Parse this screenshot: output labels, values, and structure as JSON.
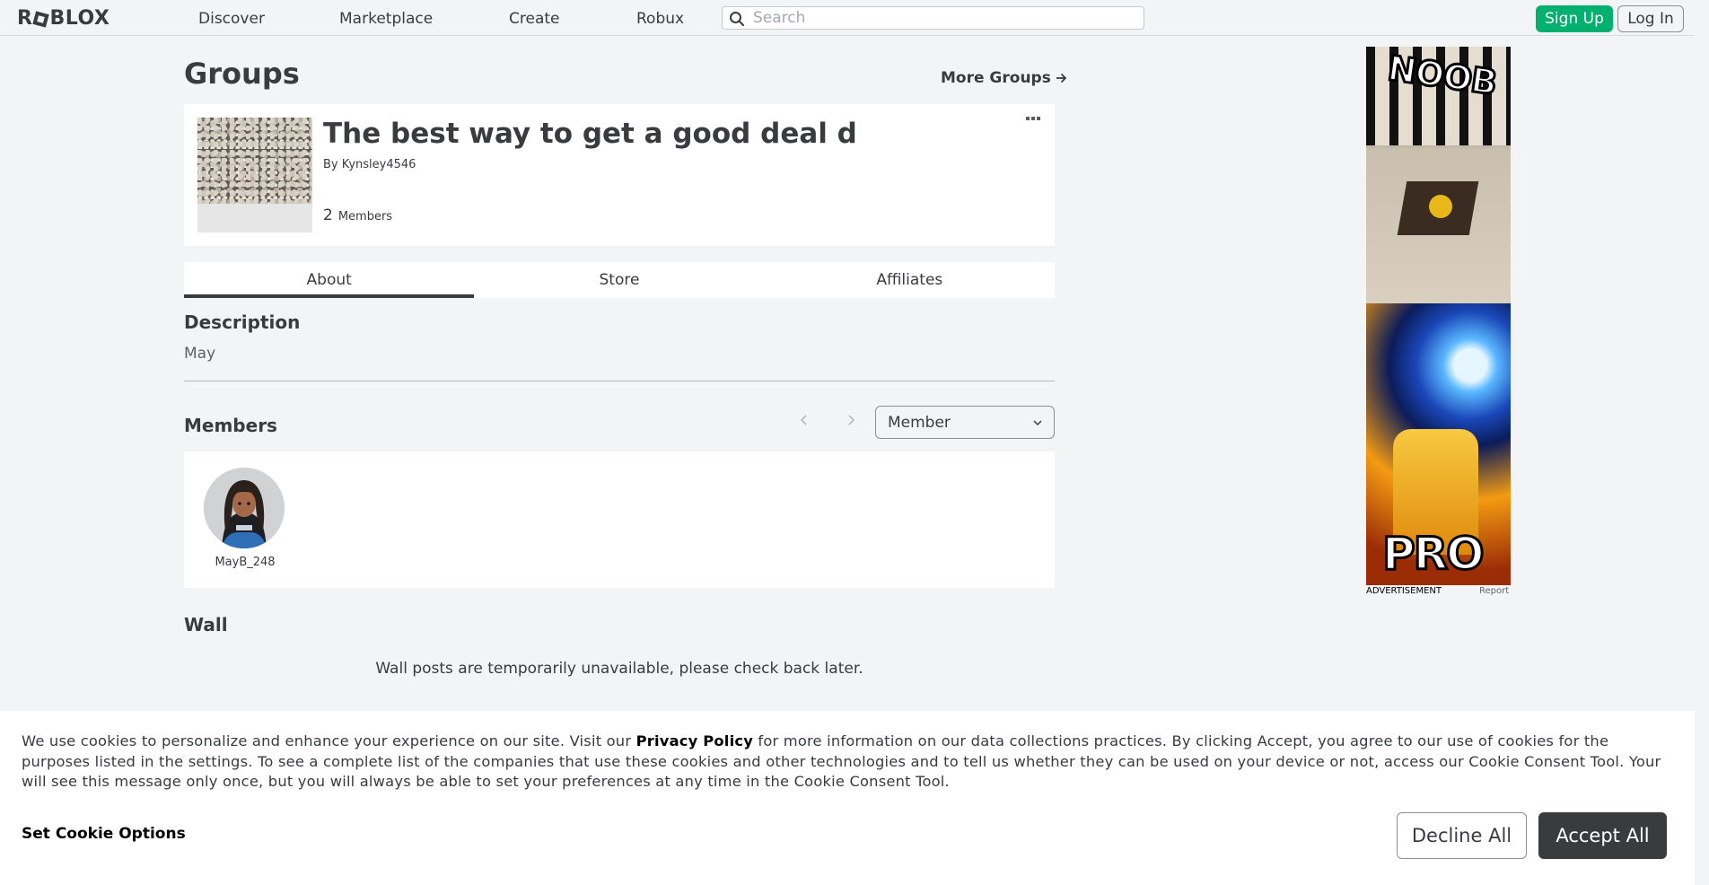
{
  "nav": {
    "logo": "ROBLOX",
    "links": [
      "Discover",
      "Marketplace",
      "Create",
      "Robux"
    ],
    "search_placeholder": "Search",
    "signup_label": "Sign Up",
    "login_label": "Log In"
  },
  "page": {
    "title": "Groups",
    "more_groups": "More Groups"
  },
  "group": {
    "name": "The best way to get a good deal d",
    "by_prefix": "By",
    "owner": "Kynsley4546",
    "member_count": "2",
    "member_label": "Members"
  },
  "tabs": [
    "About",
    "Store",
    "Affiliates"
  ],
  "description": {
    "heading": "Description",
    "text": "May"
  },
  "members": {
    "heading": "Members",
    "role_selected": "Member",
    "list": [
      {
        "name": "MayB_248"
      }
    ]
  },
  "wall": {
    "heading": "Wall",
    "message": "Wall posts are temporarily unavailable, please check back later."
  },
  "ad": {
    "top_text": "NOOB",
    "bottom_text": "PRO",
    "label": "ADVERTISEMENT",
    "report": "Report"
  },
  "cookie": {
    "text_before": "We use cookies to personalize and enhance your experience on our site. Visit our ",
    "privacy_link": "Privacy Policy",
    "text_after": " for more information on our data collections practices. By clicking Accept, you agree to our use of cookies for the purposes listed in the settings. To see a complete list of the companies that use these cookies and other technologies and to tell us whether they can be used on your device or not, access our Cookie Consent Tool. Your will see this message only once, but you will always be able to set your preferences at any time in the Cookie Consent Tool.",
    "set_options": "Set Cookie Options",
    "decline": "Decline All",
    "accept": "Accept All"
  },
  "colors": {
    "background": "#f2f4f5",
    "signup_green": "#00b06f",
    "dark_text": "#393b3d",
    "accept_button": "#393b3d"
  }
}
